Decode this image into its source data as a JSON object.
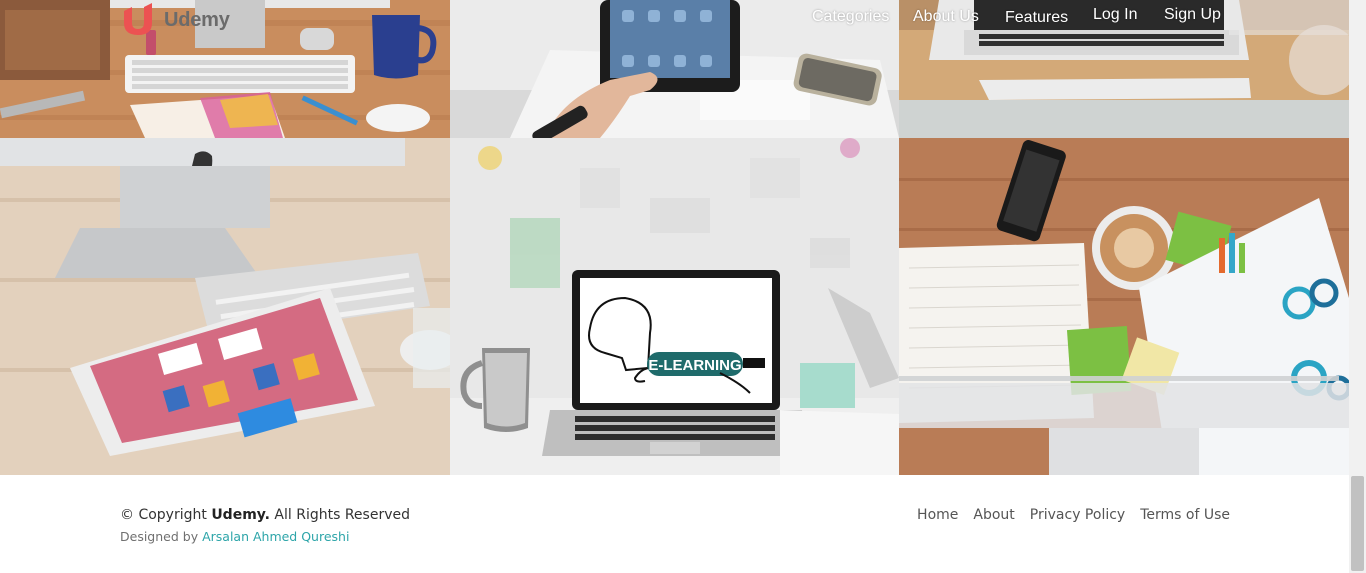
{
  "brand": {
    "name": "Udemy",
    "logo_icon": "udemy-u-logo",
    "logo_color": "#ec5252"
  },
  "nav": {
    "categories": "Categories",
    "about": "About Us",
    "features": "Features",
    "login": "Log In",
    "signup": "Sign Up"
  },
  "gallery": {
    "laptop_screen_text": "E-LEARNING"
  },
  "footer": {
    "copyright_prefix": "© Copyright",
    "copyright_brand": "Udemy.",
    "copyright_suffix": "All Rights Reserved",
    "designed_by": "Designed by",
    "designer": "Arsalan Ahmed Qureshi",
    "links": {
      "home": "Home",
      "about": "About",
      "privacy": "Privacy Policy",
      "terms": "Terms of Use"
    }
  },
  "colors": {
    "accent": "#2da5a9",
    "brand": "#ec5252"
  }
}
